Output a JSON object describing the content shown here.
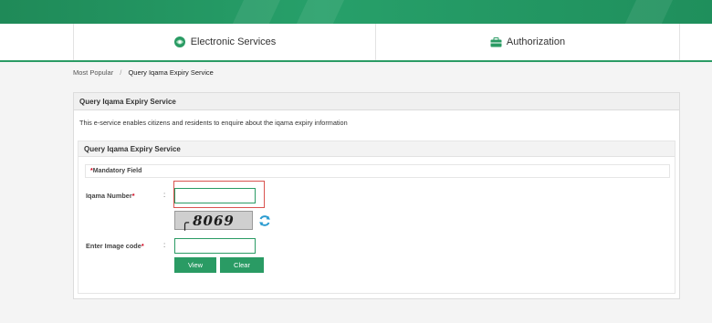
{
  "nav": {
    "electronic_services": "Electronic Services",
    "authorization": "Authorization"
  },
  "breadcrumb": {
    "parent": "Most Popular",
    "separator": "/",
    "current": "Query Iqama Expiry Service"
  },
  "panel": {
    "title": "Query Iqama Expiry Service",
    "description": "This e-service enables citizens and residents to enquire about the iqama expiry information"
  },
  "form": {
    "title": "Query Iqama Expiry Service",
    "mandatory_star": "*",
    "mandatory_label": "Mandatory Field",
    "iqama_label": "Iqama Number",
    "iqama_value": "",
    "image_code_label": "Enter Image code",
    "image_code_value": "",
    "required_star": "*",
    "colon": ":",
    "captcha_text": "8069",
    "captcha_prefix": "╭",
    "view_button": "View",
    "clear_button": "Clear"
  },
  "colors": {
    "brand_green": "#2a9b64",
    "required_red": "#d0021b",
    "highlight_border": "#d9534f"
  },
  "icons": {
    "electronic_services": "globe-hand-icon",
    "authorization": "briefcase-icon",
    "refresh": "refresh-icon"
  }
}
